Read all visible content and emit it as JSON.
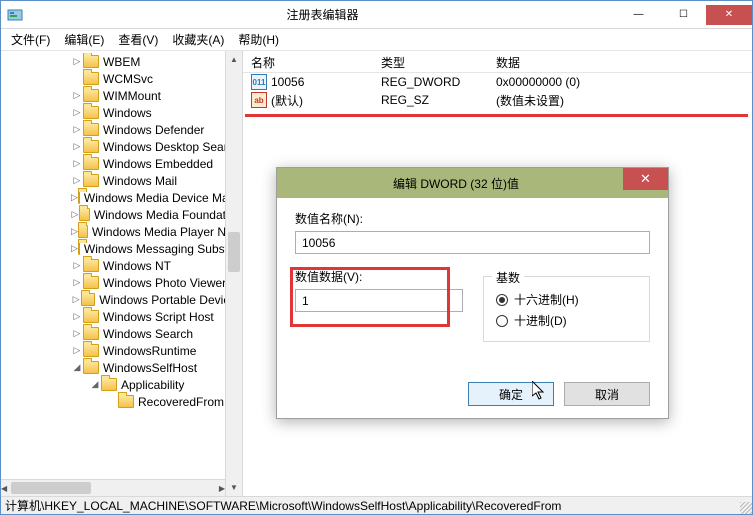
{
  "window": {
    "title": "注册表编辑器",
    "min": "—",
    "max": "☐",
    "close": "✕"
  },
  "menu": {
    "file": "文件(F)",
    "edit": "编辑(E)",
    "view": "查看(V)",
    "fav": "收藏夹(A)",
    "help": "帮助(H)"
  },
  "tree": {
    "items": [
      {
        "ind": 70,
        "exp": "▷",
        "label": "WBEM"
      },
      {
        "ind": 70,
        "exp": "",
        "label": "WCMSvc"
      },
      {
        "ind": 70,
        "exp": "▷",
        "label": "WIMMount"
      },
      {
        "ind": 70,
        "exp": "▷",
        "label": "Windows"
      },
      {
        "ind": 70,
        "exp": "▷",
        "label": "Windows Defender"
      },
      {
        "ind": 70,
        "exp": "▷",
        "label": "Windows Desktop Search"
      },
      {
        "ind": 70,
        "exp": "▷",
        "label": "Windows Embedded"
      },
      {
        "ind": 70,
        "exp": "▷",
        "label": "Windows Mail"
      },
      {
        "ind": 70,
        "exp": "▷",
        "label": "Windows Media Device Manager"
      },
      {
        "ind": 70,
        "exp": "▷",
        "label": "Windows Media Foundation"
      },
      {
        "ind": 70,
        "exp": "▷",
        "label": "Windows Media Player NSS"
      },
      {
        "ind": 70,
        "exp": "▷",
        "label": "Windows Messaging Subsystem"
      },
      {
        "ind": 70,
        "exp": "▷",
        "label": "Windows NT"
      },
      {
        "ind": 70,
        "exp": "▷",
        "label": "Windows Photo Viewer"
      },
      {
        "ind": 70,
        "exp": "▷",
        "label": "Windows Portable Devices"
      },
      {
        "ind": 70,
        "exp": "▷",
        "label": "Windows Script Host"
      },
      {
        "ind": 70,
        "exp": "▷",
        "label": "Windows Search"
      },
      {
        "ind": 70,
        "exp": "▷",
        "label": "WindowsRuntime"
      },
      {
        "ind": 70,
        "exp": "◢",
        "label": "WindowsSelfHost"
      },
      {
        "ind": 88,
        "exp": "◢",
        "label": "Applicability"
      },
      {
        "ind": 105,
        "exp": "",
        "label": "RecoveredFrom"
      }
    ]
  },
  "list": {
    "headers": {
      "name": "名称",
      "type": "类型",
      "data": "数据"
    },
    "rows": [
      {
        "icon": "str",
        "name": "(默认)",
        "type": "REG_SZ",
        "data": "(数值未设置)"
      },
      {
        "icon": "dword",
        "name": "10056",
        "type": "REG_DWORD",
        "data": "0x00000000 (0)"
      }
    ]
  },
  "dialog": {
    "title": "编辑 DWORD (32 位)值",
    "close": "✕",
    "name_label": "数值名称(N):",
    "name_value": "10056",
    "data_label": "数值数据(V):",
    "data_value": "1",
    "base_legend": "基数",
    "radio_hex": "十六进制(H)",
    "radio_dec": "十进制(D)",
    "ok": "确定",
    "cancel": "取消"
  },
  "status": "计算机\\HKEY_LOCAL_MACHINE\\SOFTWARE\\Microsoft\\WindowsSelfHost\\Applicability\\RecoveredFrom"
}
